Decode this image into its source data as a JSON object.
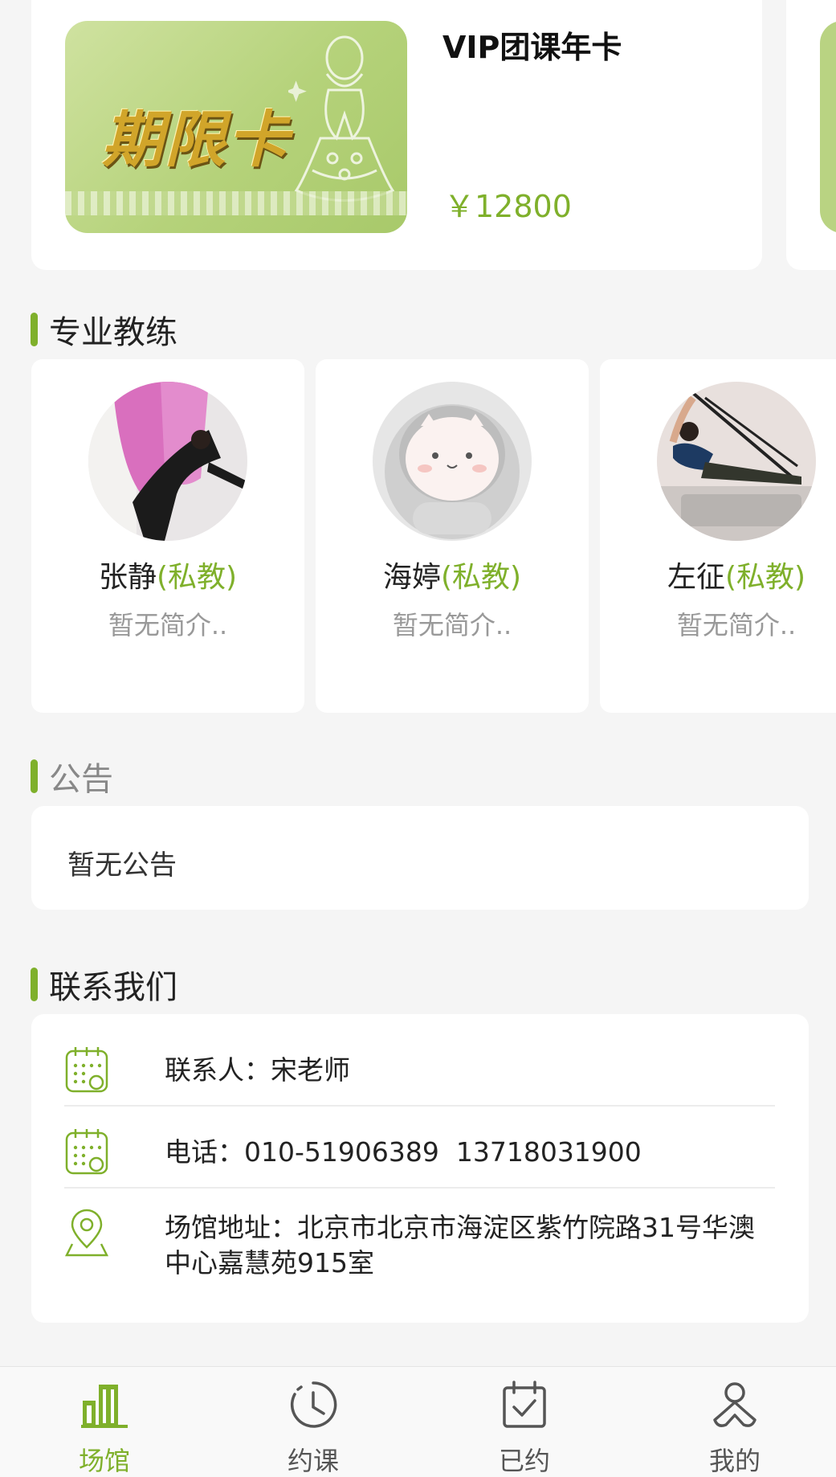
{
  "colors": {
    "accent": "#7fb02b",
    "background": "#f5f5f5"
  },
  "card": {
    "image_text": "期限卡",
    "title": "VIP团课年卡",
    "price": "￥12800"
  },
  "coaches_section": {
    "title": "专业教练"
  },
  "coaches": [
    {
      "name": "张静",
      "tag": "(私教)",
      "intro": "暂无简介.."
    },
    {
      "name": "海婷",
      "tag": "(私教)",
      "intro": "暂无简介.."
    },
    {
      "name": "左征",
      "tag": "(私教)",
      "intro": "暂无简介.."
    }
  ],
  "notice_section": {
    "title": "公告",
    "content": "暂无公告"
  },
  "contact_section": {
    "title": "联系我们",
    "contact_person": "联系人：宋老师",
    "phone": "电话：010-51906389  13718031900",
    "address": "场馆地址：北京市北京市海淀区紫竹院路31号华澳中心嘉慧苑915室"
  },
  "tabbar": {
    "items": [
      {
        "label": "场馆",
        "icon": "building-icon",
        "active": true
      },
      {
        "label": "约课",
        "icon": "clock-icon",
        "active": false
      },
      {
        "label": "已约",
        "icon": "calendar-check-icon",
        "active": false
      },
      {
        "label": "我的",
        "icon": "user-icon",
        "active": false
      }
    ]
  }
}
